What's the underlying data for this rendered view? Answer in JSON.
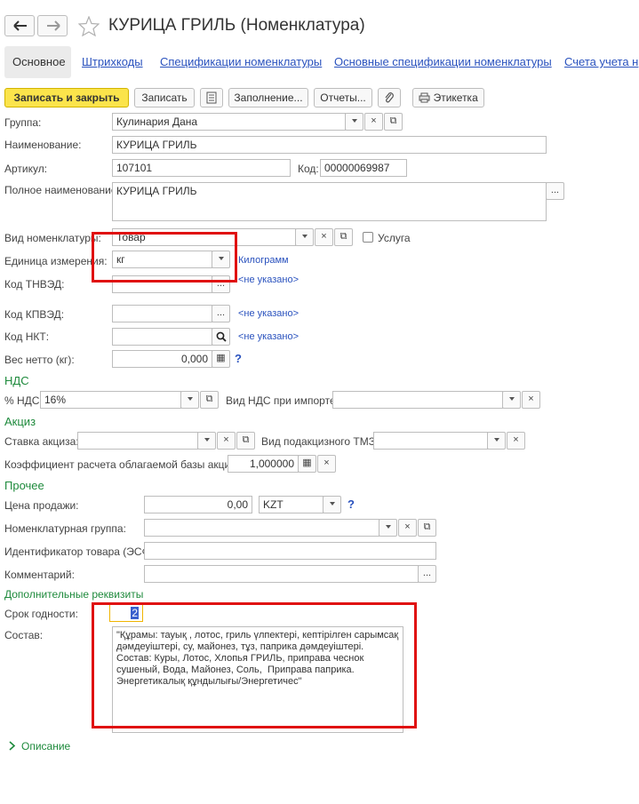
{
  "header": {
    "title": "КУРИЦА ГРИЛЬ (Номенклатура)",
    "icons": {
      "back": "arrow-left-icon",
      "forward": "arrow-right-icon",
      "favorite": "star-icon"
    }
  },
  "tabs": [
    {
      "label": "Основное"
    },
    {
      "label": "Штрихкоды"
    },
    {
      "label": "Спецификации номенклатуры"
    },
    {
      "label": "Основные спецификации номенклатуры"
    },
    {
      "label": "Счета учета н"
    }
  ],
  "toolbar": {
    "save_close": "Записать и закрыть",
    "save": "Записать",
    "fill": "Заполнение...",
    "reports": "Отчеты...",
    "label_print": "Этикетка"
  },
  "form": {
    "group": {
      "label": "Группа:",
      "value": "Кулинария Дана"
    },
    "name": {
      "label": "Наименование:",
      "value": "КУРИЦА ГРИЛЬ"
    },
    "article": {
      "label": "Артикул:",
      "value": "107101"
    },
    "code": {
      "label": "Код:",
      "value": "00000069987"
    },
    "full_name": {
      "label": "Полное наименование:",
      "value": "КУРИЦА ГРИЛЬ"
    },
    "kind": {
      "label": "Вид номенклатуры:",
      "value": "Товар"
    },
    "service": {
      "label": "Услуга"
    },
    "unit": {
      "label": "Единица измерения:",
      "value": "кг",
      "link": "Килограмм"
    },
    "tnved": {
      "label": "Код ТНВЭД:",
      "link": "<не указано>"
    },
    "kpved": {
      "label": "Код КПВЭД:",
      "link": "<не указано>"
    },
    "nkt": {
      "label": "Код НКТ:",
      "link": "<не указано>"
    },
    "net_weight": {
      "label": "Вес нетто (кг):",
      "value": "0,000",
      "help": "?"
    }
  },
  "vat": {
    "section": "НДС",
    "rate": {
      "label": "% НДС:",
      "value": "16%"
    },
    "import_kind": {
      "label": "Вид НДС при импорте:"
    }
  },
  "excise": {
    "section": "Акциз",
    "rate": {
      "label": "Ставка акциза:"
    },
    "tmz_kind": {
      "label": "Вид подакцизного ТМЗ:"
    },
    "coef": {
      "label": "Коэффициент расчета облагаемой базы акциза:",
      "value": "1,000000"
    }
  },
  "other": {
    "section": "Прочее",
    "price": {
      "label": "Цена продажи:",
      "value": "0,00",
      "currency": "KZT",
      "help": "?"
    },
    "nom_group": {
      "label": "Номенклатурная группа:"
    },
    "product_id": {
      "label": "Идентификатор товара (ЭСФ):"
    },
    "comment": {
      "label": "Комментарий:"
    }
  },
  "extra": {
    "section": "Дополнительные реквизиты",
    "shelf_life": {
      "label": "Срок годности:",
      "value": "2"
    },
    "composition": {
      "label": "Состав:",
      "value": "\"Құрамы: тауық , лотос, гриль үлпектері, кептірілген сарымсақ дәмдеуіштері, су, майонез, тұз, паприка дәмдеуіштері.\nСостав: Куры, Лотос, Хлопья ГРИЛЬ, приправа чеснок сушеный, Вода, Майонез, Соль,  Приправа паприка. Энергетикалық құндылығы/Энергетичес\""
    }
  },
  "description": {
    "label": "Описание"
  },
  "colors": {
    "accent": "#fbe44b",
    "section": "#1e8a3c",
    "link": "#2a52be",
    "highlight": "#e01010"
  }
}
